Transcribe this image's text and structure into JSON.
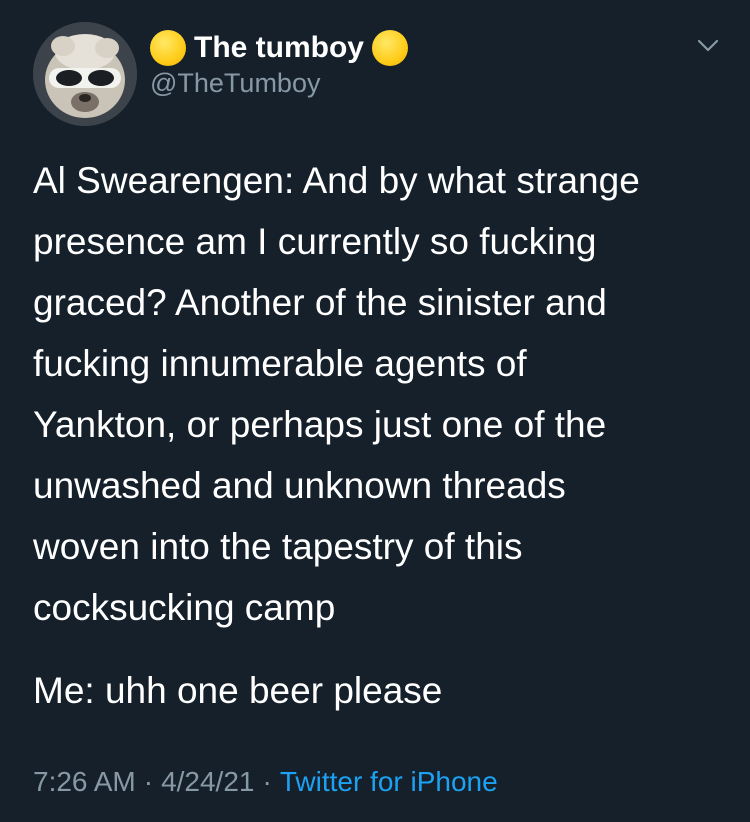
{
  "user": {
    "display_name": "The tumboy",
    "handle": "@TheTumboy",
    "name_emoji_left": "yellow-circle-emoji",
    "name_emoji_right": "yellow-circle-emoji"
  },
  "tweet": {
    "lines": [
      "Al Swearengen: And by what strange",
      "presence am I currently so fucking",
      "graced? Another of the sinister and",
      "fucking innumerable agents of",
      "Yankton, or perhaps just one of the",
      "unwashed and unknown threads",
      "woven into the tapestry of this",
      "cocksucking camp"
    ],
    "reply_line": "Me: uhh one beer please"
  },
  "meta": {
    "time": "7:26 AM",
    "date": "4/24/21",
    "separator": "·",
    "source": "Twitter for iPhone"
  },
  "icons": {
    "menu": "chevron-down-icon"
  },
  "colors": {
    "background": "#15202b",
    "text": "#ffffff",
    "secondary": "#8899a6",
    "link": "#1da1f2",
    "emoji_yellow": "#ffcc1a"
  }
}
